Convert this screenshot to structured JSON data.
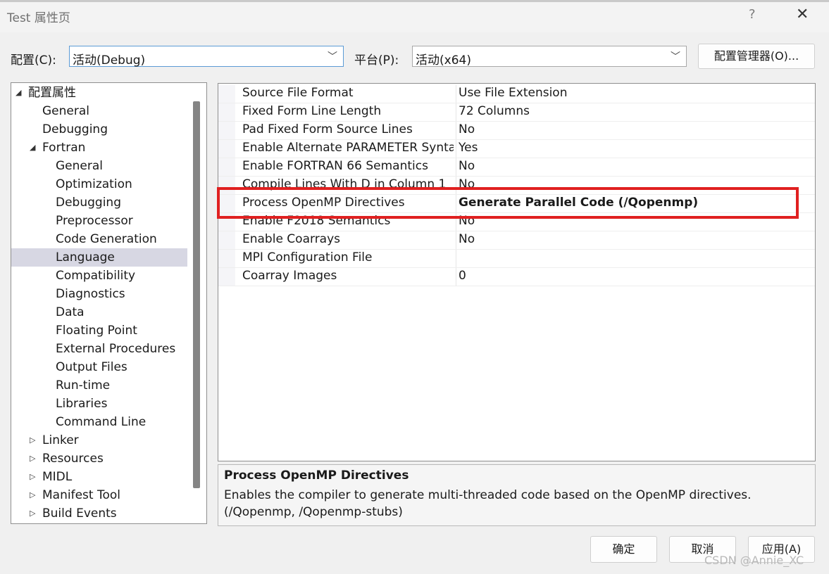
{
  "window": {
    "title": "Test 属性页",
    "help": "?",
    "close": "✕"
  },
  "toolbar": {
    "config_label": "配置(C):",
    "config_value": "活动(Debug)",
    "platform_label": "平台(P):",
    "platform_value": "活动(x64)",
    "config_manager": "配置管理器(O)..."
  },
  "tree": {
    "items": [
      {
        "label": "配置属性",
        "expander": "◢",
        "level": 0
      },
      {
        "label": "General",
        "expander": "",
        "level": 1
      },
      {
        "label": "Debugging",
        "expander": "",
        "level": 1
      },
      {
        "label": "Fortran",
        "expander": "◢",
        "level": 1
      },
      {
        "label": "General",
        "expander": "",
        "level": 2
      },
      {
        "label": "Optimization",
        "expander": "",
        "level": 2
      },
      {
        "label": "Debugging",
        "expander": "",
        "level": 2
      },
      {
        "label": "Preprocessor",
        "expander": "",
        "level": 2
      },
      {
        "label": "Code Generation",
        "expander": "",
        "level": 2
      },
      {
        "label": "Language",
        "expander": "",
        "level": 2,
        "selected": true
      },
      {
        "label": "Compatibility",
        "expander": "",
        "level": 2
      },
      {
        "label": "Diagnostics",
        "expander": "",
        "level": 2
      },
      {
        "label": "Data",
        "expander": "",
        "level": 2
      },
      {
        "label": "Floating Point",
        "expander": "",
        "level": 2
      },
      {
        "label": "External Procedures",
        "expander": "",
        "level": 2
      },
      {
        "label": "Output Files",
        "expander": "",
        "level": 2
      },
      {
        "label": "Run-time",
        "expander": "",
        "level": 2
      },
      {
        "label": "Libraries",
        "expander": "",
        "level": 2
      },
      {
        "label": "Command Line",
        "expander": "",
        "level": 2
      },
      {
        "label": "Linker",
        "expander": "▷",
        "level": 1
      },
      {
        "label": "Resources",
        "expander": "▷",
        "level": 1
      },
      {
        "label": "MIDL",
        "expander": "▷",
        "level": 1
      },
      {
        "label": "Manifest Tool",
        "expander": "▷",
        "level": 1
      },
      {
        "label": "Build Events",
        "expander": "▷",
        "level": 1
      }
    ]
  },
  "properties": [
    {
      "name": "Source File Format",
      "value": "Use File Extension",
      "bold": false
    },
    {
      "name": "Fixed Form Line Length",
      "value": "72 Columns",
      "bold": false
    },
    {
      "name": "Pad Fixed Form Source Lines",
      "value": "No",
      "bold": false
    },
    {
      "name": "Enable Alternate PARAMETER Syntax",
      "value": "Yes",
      "bold": false
    },
    {
      "name": "Enable FORTRAN 66 Semantics",
      "value": "No",
      "bold": false
    },
    {
      "name": "Compile Lines With D in Column 1",
      "value": "No",
      "bold": false
    },
    {
      "name": "Process OpenMP Directives",
      "value": "Generate Parallel Code (/Qopenmp)",
      "bold": true
    },
    {
      "name": "Enable F2018 Semantics",
      "value": "No",
      "bold": false
    },
    {
      "name": "Enable Coarrays",
      "value": "No",
      "bold": false
    },
    {
      "name": "MPI Configuration File",
      "value": "",
      "bold": false
    },
    {
      "name": "Coarray Images",
      "value": "0",
      "bold": false
    }
  ],
  "description": {
    "title": "Process OpenMP Directives",
    "body": "Enables the compiler to generate multi-threaded code based on the OpenMP directives. (/Qopenmp, /Qopenmp-stubs)"
  },
  "buttons": {
    "ok": "确定",
    "cancel": "取消",
    "apply": "应用(A)"
  },
  "watermark": "CSDN @Annie_XC",
  "colors": {
    "highlight": "#e02020",
    "selection": "#d7d7e3",
    "focus": "#5b9bd5"
  }
}
